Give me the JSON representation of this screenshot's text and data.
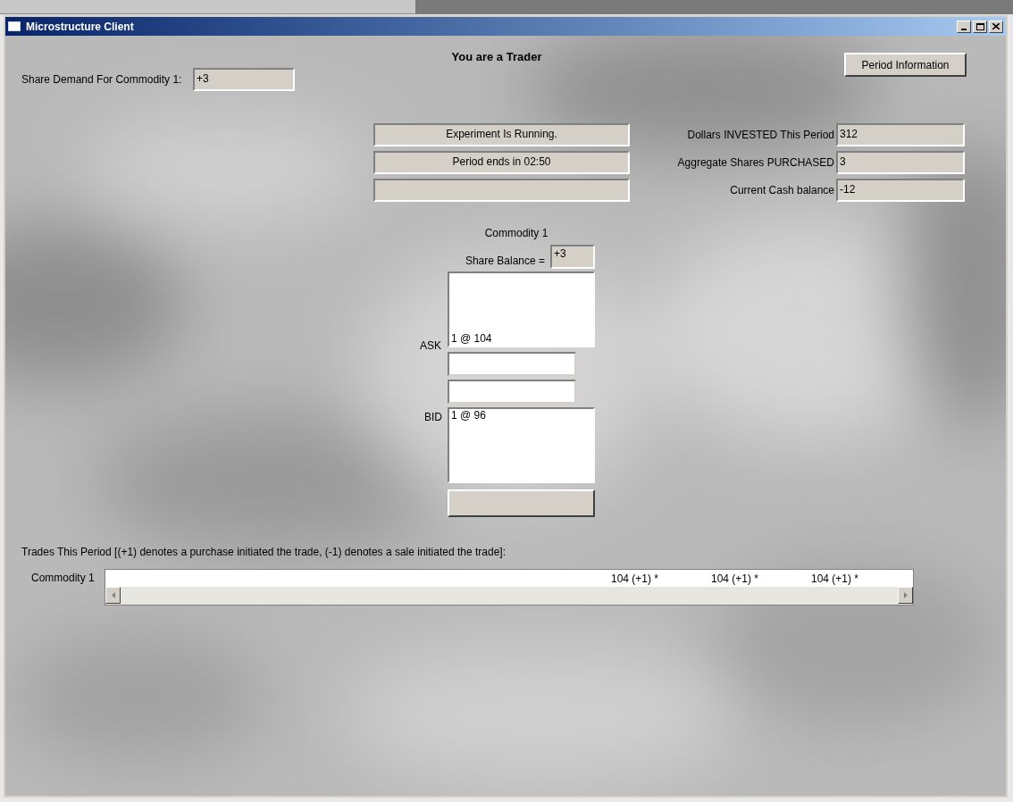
{
  "window": {
    "title": "Microstructure Client"
  },
  "heading": "You are a Trader",
  "period_info_button": "Period Information",
  "share_demand": {
    "label": "Share Demand For Commodity 1:",
    "value": "+3"
  },
  "status_boxes": [
    {
      "kind": "text",
      "text": "Experiment Is Running."
    },
    {
      "kind": "text",
      "text": "Period ends in 02:50"
    },
    {
      "kind": "blank"
    }
  ],
  "stats": [
    {
      "label": "Dollars INVESTED This Period",
      "value": "312"
    },
    {
      "label": "Aggregate Shares PURCHASED",
      "value": "3"
    },
    {
      "label": "Current Cash balance",
      "value": "-12"
    }
  ],
  "commodity": {
    "title": "Commodity 1",
    "balance_label": "Share Balance =",
    "balance": "+3",
    "ask_label": "ASK",
    "asks": [
      "1 @ 104"
    ],
    "bid_label": "BID",
    "bids": [
      "1 @ 96"
    ]
  },
  "trades": {
    "caption": "Trades This Period [(+1) denotes a purchase initiated the trade, (-1) denotes a sale initiated the trade]:",
    "row_label": "Commodity 1",
    "entries": [
      "104 (+1) *",
      "104 (+1) *",
      "104 (+1) *"
    ]
  }
}
